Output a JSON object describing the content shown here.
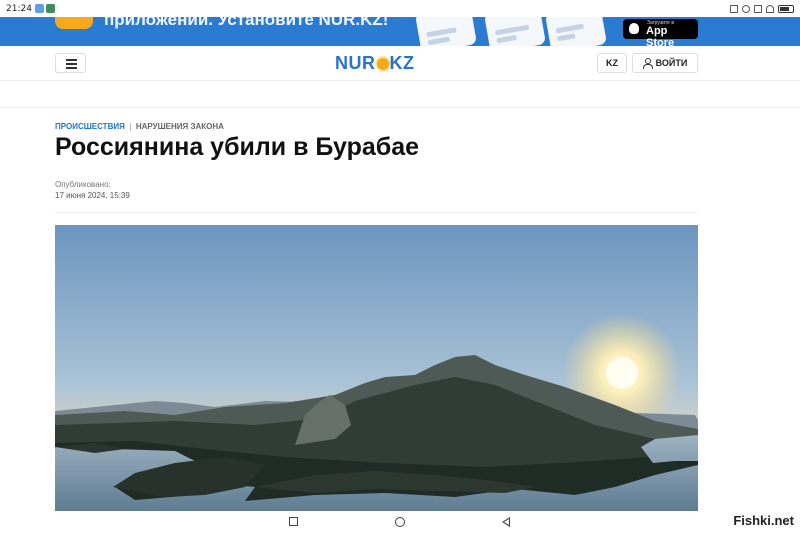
{
  "status_bar": {
    "time": "21:24"
  },
  "banner": {
    "text": "приложении. Установите NUR.KZ!",
    "appstore_small": "Загрузите в",
    "appstore_big": "App Store"
  },
  "header": {
    "logo_left": "NUR",
    "logo_right": "KZ",
    "lang_button": "KZ",
    "login_button": "ВОЙТИ"
  },
  "article": {
    "category": "ПРОИСШЕСТВИЯ",
    "subcategory": "НАРУШЕНИЯ ЗАКОНА",
    "title": "Россиянина убили в Бурабае",
    "published_label": "Опубликовано:",
    "published_date": "17 июня 2024, 15:39"
  },
  "watermark": "Fishki.net",
  "colors": {
    "brand": "#2773ce",
    "banner": "#2b7bd3",
    "accent": "#f6a917"
  },
  "icons": [
    "menu-icon",
    "user-icon",
    "apple-icon",
    "sun-logo-icon",
    "nav-recents-icon",
    "nav-home-icon",
    "nav-back-icon"
  ]
}
